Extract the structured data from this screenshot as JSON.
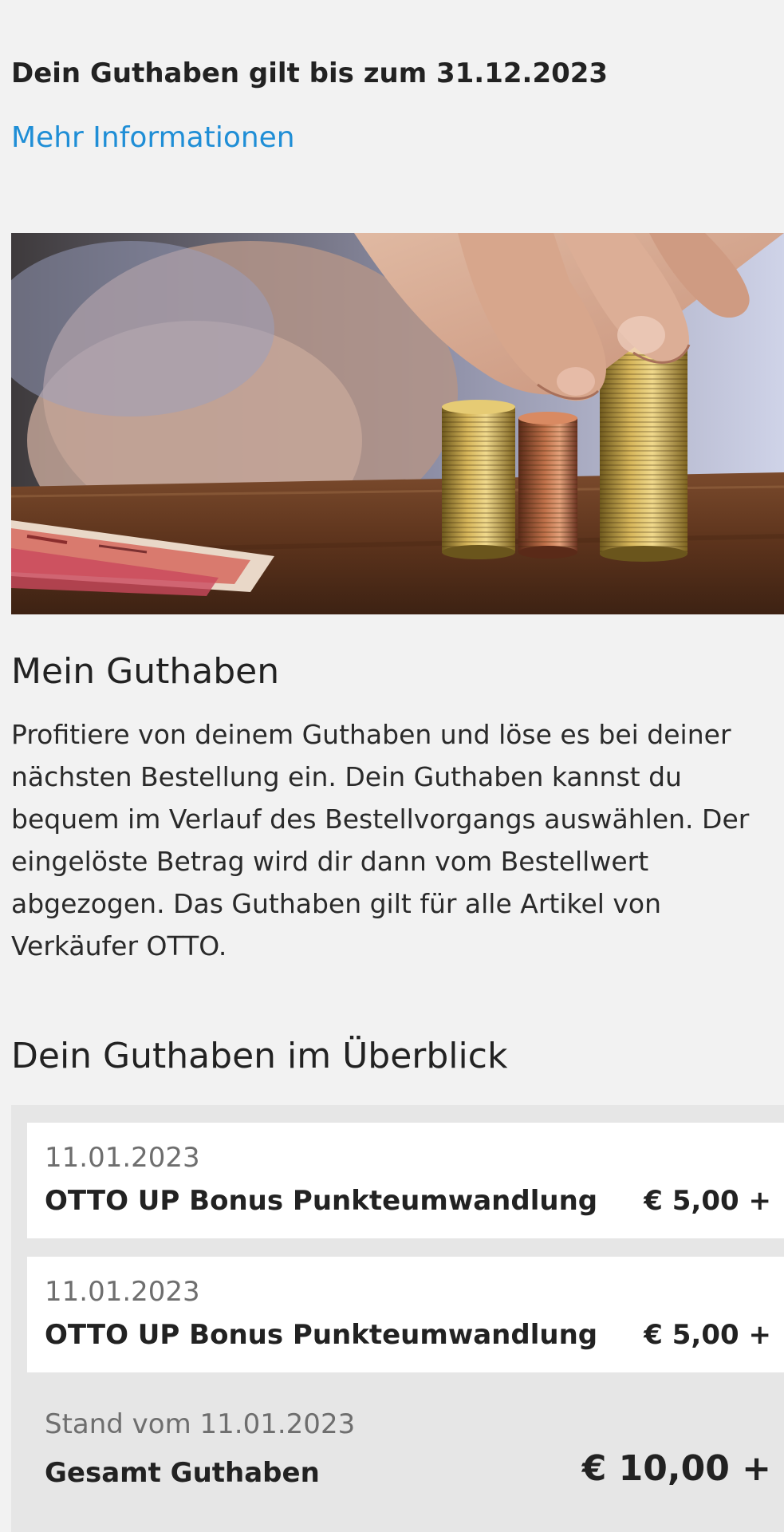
{
  "header": {
    "validity_text": "Dein Guthaben gilt bis zum 31.12.2023",
    "more_info_link": "Mehr Informationen"
  },
  "hero": {
    "description": "Hand stacking coins on a wooden table next to banknotes"
  },
  "credit_info": {
    "title": "Mein Guthaben",
    "text": "Profitiere von deinem Guthaben und löse es bei deiner nächsten Bestellung ein. Dein Guthaben kannst du bequem im Verlauf des Bestellvorgangs auswählen. Der eingelöste Betrag wird dir dann vom Bestellwert abgezogen. Das Guthaben gilt für alle Artikel von Verkäufer OTTO."
  },
  "overview": {
    "title": "Dein Guthaben im Überblick",
    "entries": [
      {
        "date": "11.01.2023",
        "title": "OTTO UP Bonus Punkteumwandlung",
        "amount": "€ 5,00 +"
      },
      {
        "date": "11.01.2023",
        "title": "OTTO UP Bonus Punkteumwandlung",
        "amount": "€ 5,00 +"
      }
    ],
    "total": {
      "date_text": "Stand vom 11.01.2023",
      "label": "Gesamt Guthaben",
      "amount": "€ 10,00 +"
    }
  },
  "colors": {
    "background": "#f2f2f2",
    "link": "#1f8ed6",
    "card": "#ffffff",
    "panel": "#e6e6e6",
    "text": "#222222",
    "muted_text": "#6e6e6e"
  }
}
